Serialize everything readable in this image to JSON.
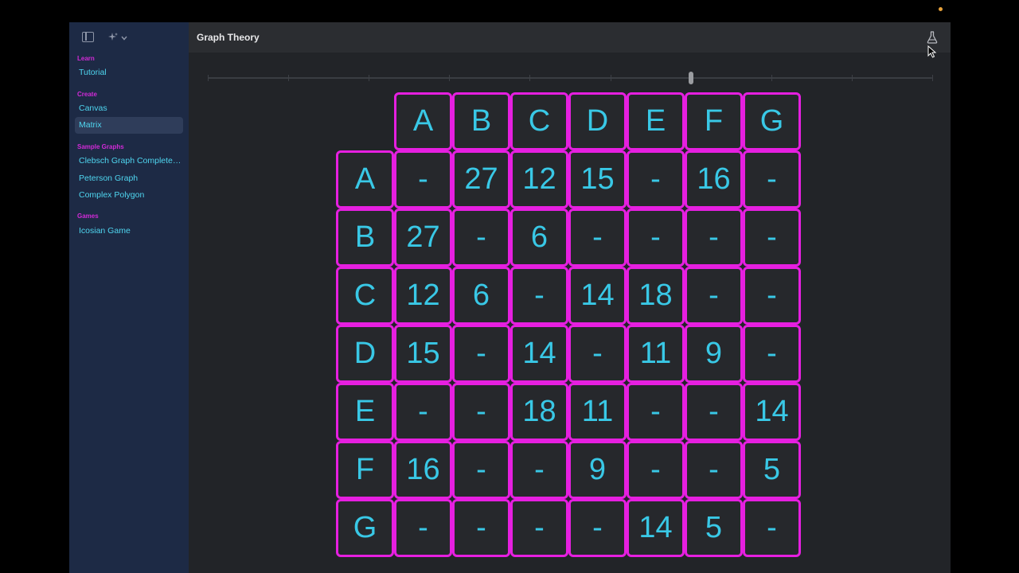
{
  "app": {
    "title": "Graph Theory"
  },
  "sidebar": {
    "sections": [
      {
        "title": "Learn",
        "items": [
          {
            "label": "Tutorial",
            "selected": false
          }
        ]
      },
      {
        "title": "Create",
        "items": [
          {
            "label": "Canvas",
            "selected": false
          },
          {
            "label": "Matrix",
            "selected": true
          }
        ]
      },
      {
        "title": "Sample Graphs",
        "items": [
          {
            "label": "Clebsch Graph Complete Graph",
            "selected": false
          },
          {
            "label": "Peterson Graph",
            "selected": false
          },
          {
            "label": "Complex Polygon",
            "selected": false
          }
        ]
      },
      {
        "title": "Games",
        "items": [
          {
            "label": "Icosian Game",
            "selected": false
          }
        ]
      }
    ]
  },
  "toolbar": {
    "flask_icon": "flask-icon",
    "sidebar_toggle_icon": "sidebar-toggle-icon",
    "sparkle_icon": "sparkle-icon"
  },
  "slider": {
    "ticks": 10,
    "value_fraction": 0.667
  },
  "matrix": {
    "headers": [
      "A",
      "B",
      "C",
      "D",
      "E",
      "F",
      "G"
    ],
    "rows": [
      {
        "label": "A",
        "cells": [
          "-",
          "27",
          "12",
          "15",
          "-",
          "16",
          "-"
        ]
      },
      {
        "label": "B",
        "cells": [
          "27",
          "-",
          "6",
          "-",
          "-",
          "-",
          "-"
        ]
      },
      {
        "label": "C",
        "cells": [
          "12",
          "6",
          "-",
          "14",
          "18",
          "-",
          "-"
        ]
      },
      {
        "label": "D",
        "cells": [
          "15",
          "-",
          "14",
          "-",
          "11",
          "9",
          "-"
        ]
      },
      {
        "label": "E",
        "cells": [
          "-",
          "-",
          "18",
          "11",
          "-",
          "-",
          "14"
        ]
      },
      {
        "label": "F",
        "cells": [
          "16",
          "-",
          "-",
          "9",
          "-",
          "-",
          "5"
        ]
      },
      {
        "label": "G",
        "cells": [
          "-",
          "-",
          "-",
          "-",
          "14",
          "5",
          "-"
        ]
      }
    ]
  },
  "colors": {
    "accent_magenta": "#e61fe0",
    "accent_cyan": "#39c8e6",
    "sidebar_bg": "#1d2a45"
  }
}
